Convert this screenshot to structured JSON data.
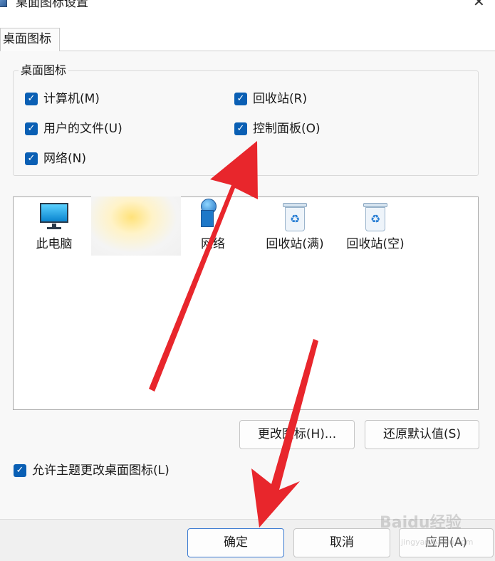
{
  "window": {
    "title": "桌面图标设置",
    "close_glyph": "✕"
  },
  "tab": {
    "label": "桌面图标"
  },
  "desktop_icons_group": {
    "title": "桌面图标",
    "checkboxes": [
      {
        "label": "计算机(M)",
        "checked": true
      },
      {
        "label": "回收站(R)",
        "checked": true
      },
      {
        "label": "用户的文件(U)",
        "checked": true
      },
      {
        "label": "控制面板(O)",
        "checked": true
      },
      {
        "label": "网络(N)",
        "checked": true
      }
    ]
  },
  "icon_list": {
    "items": [
      {
        "label": "此电脑",
        "icon": "monitor-icon"
      },
      {
        "label": "网络",
        "icon": "network-icon"
      },
      {
        "label": "回收站(满)",
        "icon": "recycle-bin-full-icon"
      },
      {
        "label": "回收站(空)",
        "icon": "recycle-bin-empty-icon"
      }
    ]
  },
  "buttons": {
    "change_icon": "更改图标(H)...",
    "restore_default": "还原默认值(S)",
    "ok": "确定",
    "cancel": "取消",
    "apply": "应用(A)"
  },
  "allow_themes_checkbox": {
    "label": "允许主题更改桌面图标(L)",
    "checked": true
  },
  "watermark": {
    "text": "Baidu经验",
    "sub": "jingyan.baidu.com"
  },
  "colors": {
    "checkbox": "#0a5fb4",
    "arrow": "#e8262c",
    "primary_border": "#3b7bd1"
  },
  "checkmark_glyph": "✓",
  "recycle_glyph": "♻"
}
